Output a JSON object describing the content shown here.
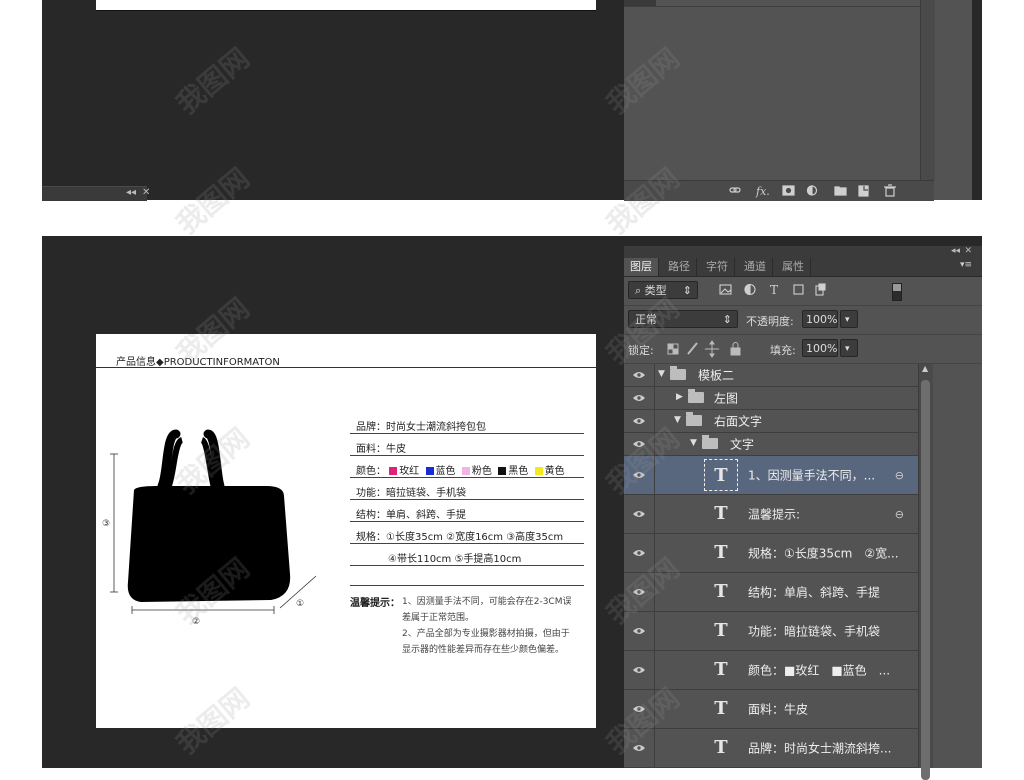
{
  "top_status": {
    "nav": "◂◂",
    "close": "✕"
  },
  "top_toolbar_icons": [
    "link-icon",
    "fx-icon",
    "mask-icon",
    "adjustment-icon",
    "folder-icon",
    "new-layer-icon",
    "trash-icon"
  ],
  "panel": {
    "header": {
      "collapse": "◂◂",
      "close": "✕"
    },
    "tabs": [
      "图层",
      "路径",
      "字符",
      "通道",
      "属性"
    ],
    "menu_icon": "▾≡",
    "filter": {
      "kind": "类型"
    },
    "blend_mode": "正常",
    "opacity_label": "不透明度:",
    "opacity_value": "100%",
    "lock_label": "锁定:",
    "fill_label": "填充:",
    "fill_value": "100%",
    "layers": [
      {
        "name": "模板二",
        "type": "group",
        "level": 0,
        "expanded": true
      },
      {
        "name": "左图",
        "type": "group",
        "level": 1,
        "expanded": false
      },
      {
        "name": "右面文字",
        "type": "group",
        "level": 1,
        "expanded": true
      },
      {
        "name": "文字",
        "type": "group",
        "level": 2,
        "expanded": true
      },
      {
        "name": "1、因测量手法不同，...",
        "type": "text",
        "selected": true,
        "linked": true
      },
      {
        "name": "温馨提示:",
        "type": "text",
        "linked": true
      },
      {
        "name": "规格：①长度35cm　②宽...",
        "type": "text"
      },
      {
        "name": "结构：单肩、斜跨、手提",
        "type": "text"
      },
      {
        "name": "功能：暗拉链袋、手机袋",
        "type": "text"
      },
      {
        "name": "颜色：■玫红　■蓝色　...",
        "type": "text"
      },
      {
        "name": "面料：牛皮",
        "type": "text"
      },
      {
        "name": "品牌：时尚女士潮流斜挎...",
        "type": "text"
      }
    ]
  },
  "doc": {
    "header": "产品信息◆PRODUCTINFORMATON",
    "brand": "品牌：时尚女士潮流斜挎包包",
    "fabric": "面料：牛皮",
    "color_label": "颜色：",
    "colors": [
      {
        "name": "玫红",
        "hex": "#e0217a"
      },
      {
        "name": "蓝色",
        "hex": "#1a2bd6"
      },
      {
        "name": "粉色",
        "hex": "#f0b4e8"
      },
      {
        "name": "黑色",
        "hex": "#111111"
      },
      {
        "name": "黄色",
        "hex": "#f2ea1c"
      }
    ],
    "function": "功能：暗拉链袋、手机袋",
    "structure": "结构：单肩、斜跨、手提",
    "spec1": "规格：①长度35cm ②宽度16cm ③高度35cm",
    "spec2": "④带长110cm ⑤手提高10cm",
    "tip_label": "温馨提示：",
    "tip1a": "1、因测量手法不同，可能会存在2-3CM误",
    "tip1b": "差属于正常范围。",
    "tip2a": "2、产品全部为专业摄影器材拍摄，但由于",
    "tip2b": "显示器的性能差异而存在些少颜色偏差。",
    "dim_labels": [
      "③",
      "②",
      "①"
    ]
  },
  "watermark": "我图网"
}
